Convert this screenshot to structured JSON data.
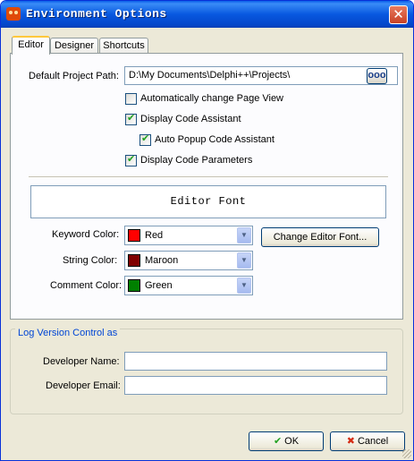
{
  "window": {
    "title": "Environment Options",
    "close_glyph": "✕"
  },
  "tabs": [
    {
      "label": "Editor"
    },
    {
      "label": "Designer"
    },
    {
      "label": "Shortcuts"
    }
  ],
  "editor": {
    "project_path_label": "Default Project Path:",
    "project_path_value": "D:\\My Documents\\Delphi++\\Projects\\",
    "browse_label": "ooo",
    "checkboxes": [
      {
        "label": "Automatically change Page View",
        "checked": false
      },
      {
        "label": "Display Code Assistant",
        "checked": true
      },
      {
        "label": "Auto Popup Code Assistant",
        "checked": true
      },
      {
        "label": "Display Code Parameters",
        "checked": true
      }
    ],
    "check_glyph": "✔",
    "font_preview": "Editor Font",
    "keyword_color_label": "Keyword Color:",
    "keyword_color_value": "Red",
    "keyword_color_hex": "#ff0000",
    "string_color_label": "String Color:",
    "string_color_value": "Maroon",
    "string_color_hex": "#800000",
    "comment_color_label": "Comment Color:",
    "comment_color_value": "Green",
    "comment_color_hex": "#008000",
    "dropdown_glyph": "▼",
    "change_font_label": "Change Editor Font..."
  },
  "version_control": {
    "group_title": "Log Version Control as",
    "developer_name_label": "Developer Name:",
    "developer_name_value": "",
    "developer_email_label": "Developer Email:",
    "developer_email_value": ""
  },
  "buttons": {
    "ok_label": "OK",
    "ok_glyph": "✔",
    "cancel_label": "Cancel",
    "cancel_glyph": "✖"
  }
}
